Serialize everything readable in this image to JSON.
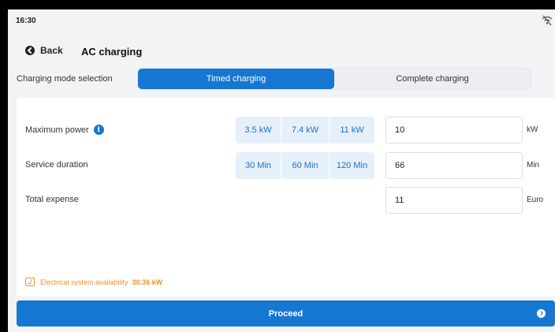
{
  "status_bar": {
    "time": "16:30",
    "icon": "wifi-off-icon"
  },
  "header": {
    "back_label": "Back",
    "title": "AC charging"
  },
  "mode": {
    "label": "Charging mode selection",
    "tabs": [
      {
        "label": "Timed charging",
        "active": true
      },
      {
        "label": "Complete charging",
        "active": false
      }
    ]
  },
  "rows": {
    "power": {
      "label": "Maximum power",
      "presets": [
        "3.5 kW",
        "7.4 kW",
        "11 kW"
      ],
      "value": "10",
      "unit": "kW"
    },
    "duration": {
      "label": "Service duration",
      "presets": [
        "30 Min",
        "60 Min",
        "120 Min"
      ],
      "value": "66",
      "unit": "Min"
    },
    "expense": {
      "label": "Total expense",
      "value": "11",
      "unit": "Euro"
    }
  },
  "availability": {
    "label": "Electrical system availability",
    "value": "30.36 kW"
  },
  "proceed": {
    "label": "Proceed"
  },
  "colors": {
    "accent": "#1677d2",
    "warning": "#e8932c",
    "preset_bg": "#e6f0fb"
  }
}
